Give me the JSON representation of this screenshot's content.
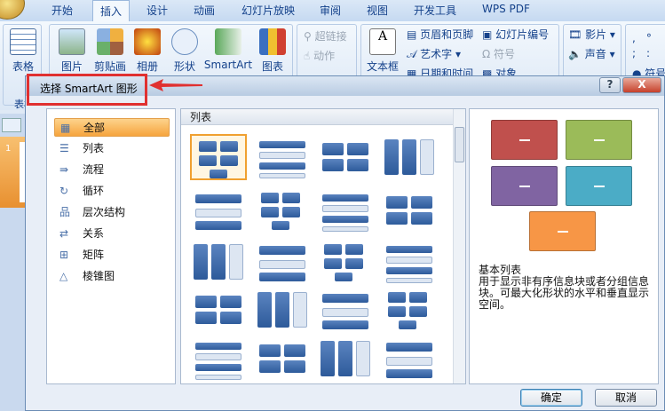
{
  "ribbon": {
    "tabs": [
      "开始",
      "插入",
      "设计",
      "动画",
      "幻灯片放映",
      "审阅",
      "视图",
      "开发工具",
      "WPS PDF"
    ],
    "active_tab": "插入",
    "buttons": {
      "table": "表格",
      "picture": "图片",
      "clipart": "剪贴画",
      "album": "相册",
      "shapes": "形状",
      "smartart": "SmartArt",
      "chart": "图表",
      "hyperlink": "超链接",
      "action": "动作",
      "textbox": "文本框",
      "header_footer": "页眉和页脚",
      "wordart": "艺术字",
      "datetime": "日期和时间",
      "slide_number": "幻灯片编号",
      "symbol": "符号",
      "object": "对象",
      "movie": "影片",
      "sound": "声音",
      "symbols2": "符号"
    },
    "group_label": "表格"
  },
  "slides": {
    "number": "1"
  },
  "dialog": {
    "title": "选择 SmartArt 图形",
    "help": "?",
    "close": "X",
    "categories": [
      "全部",
      "列表",
      "流程",
      "循环",
      "层次结构",
      "关系",
      "矩阵",
      "棱锥图"
    ],
    "selected_category": "全部",
    "gallery_header": "列表",
    "preview": {
      "title": "基本列表",
      "description": "用于显示非有序信息块或者分组信息块。可最大化形状的水平和垂直显示空间。",
      "colors": [
        "#c0504d",
        "#9bbb59",
        "#8064a2",
        "#4bacc6",
        "#f79646"
      ]
    },
    "ok": "确定",
    "cancel": "取消"
  },
  "annotation_color": "#e03030"
}
